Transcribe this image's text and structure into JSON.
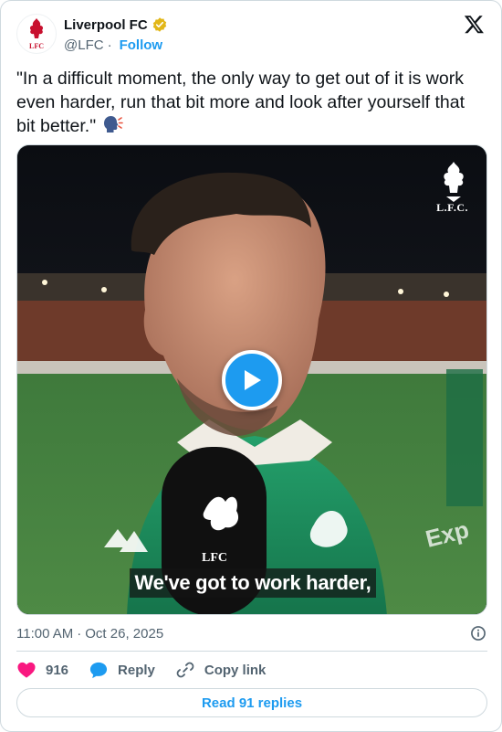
{
  "author": {
    "name": "Liverpool FC",
    "handle": "@LFC",
    "separator": "·",
    "follow_label": "Follow",
    "avatar_text": "LFC",
    "verified": true
  },
  "tweet": {
    "text": "\"In a difficult moment, the only way to get out of it is work even harder, run that bit more and look after yourself that bit better.\" ",
    "emoji": "speaking-head"
  },
  "media": {
    "subtitle": "We've got to work harder,",
    "watermark": "L.F.C.",
    "mic_text": "LFC",
    "play_icon": "play-icon"
  },
  "meta": {
    "time": "11:00 AM",
    "separator": "·",
    "date": "Oct 26, 2025"
  },
  "actions": {
    "like_count": "916",
    "reply_label": "Reply",
    "copy_label": "Copy link"
  },
  "read_replies_label": "Read 91 replies",
  "colors": {
    "accent": "#1d9bf0",
    "like": "#f91880",
    "text": "#0f1419",
    "muted": "#536471",
    "verified_gold": "#e2b719",
    "kit_green": "#1f8a5c"
  }
}
